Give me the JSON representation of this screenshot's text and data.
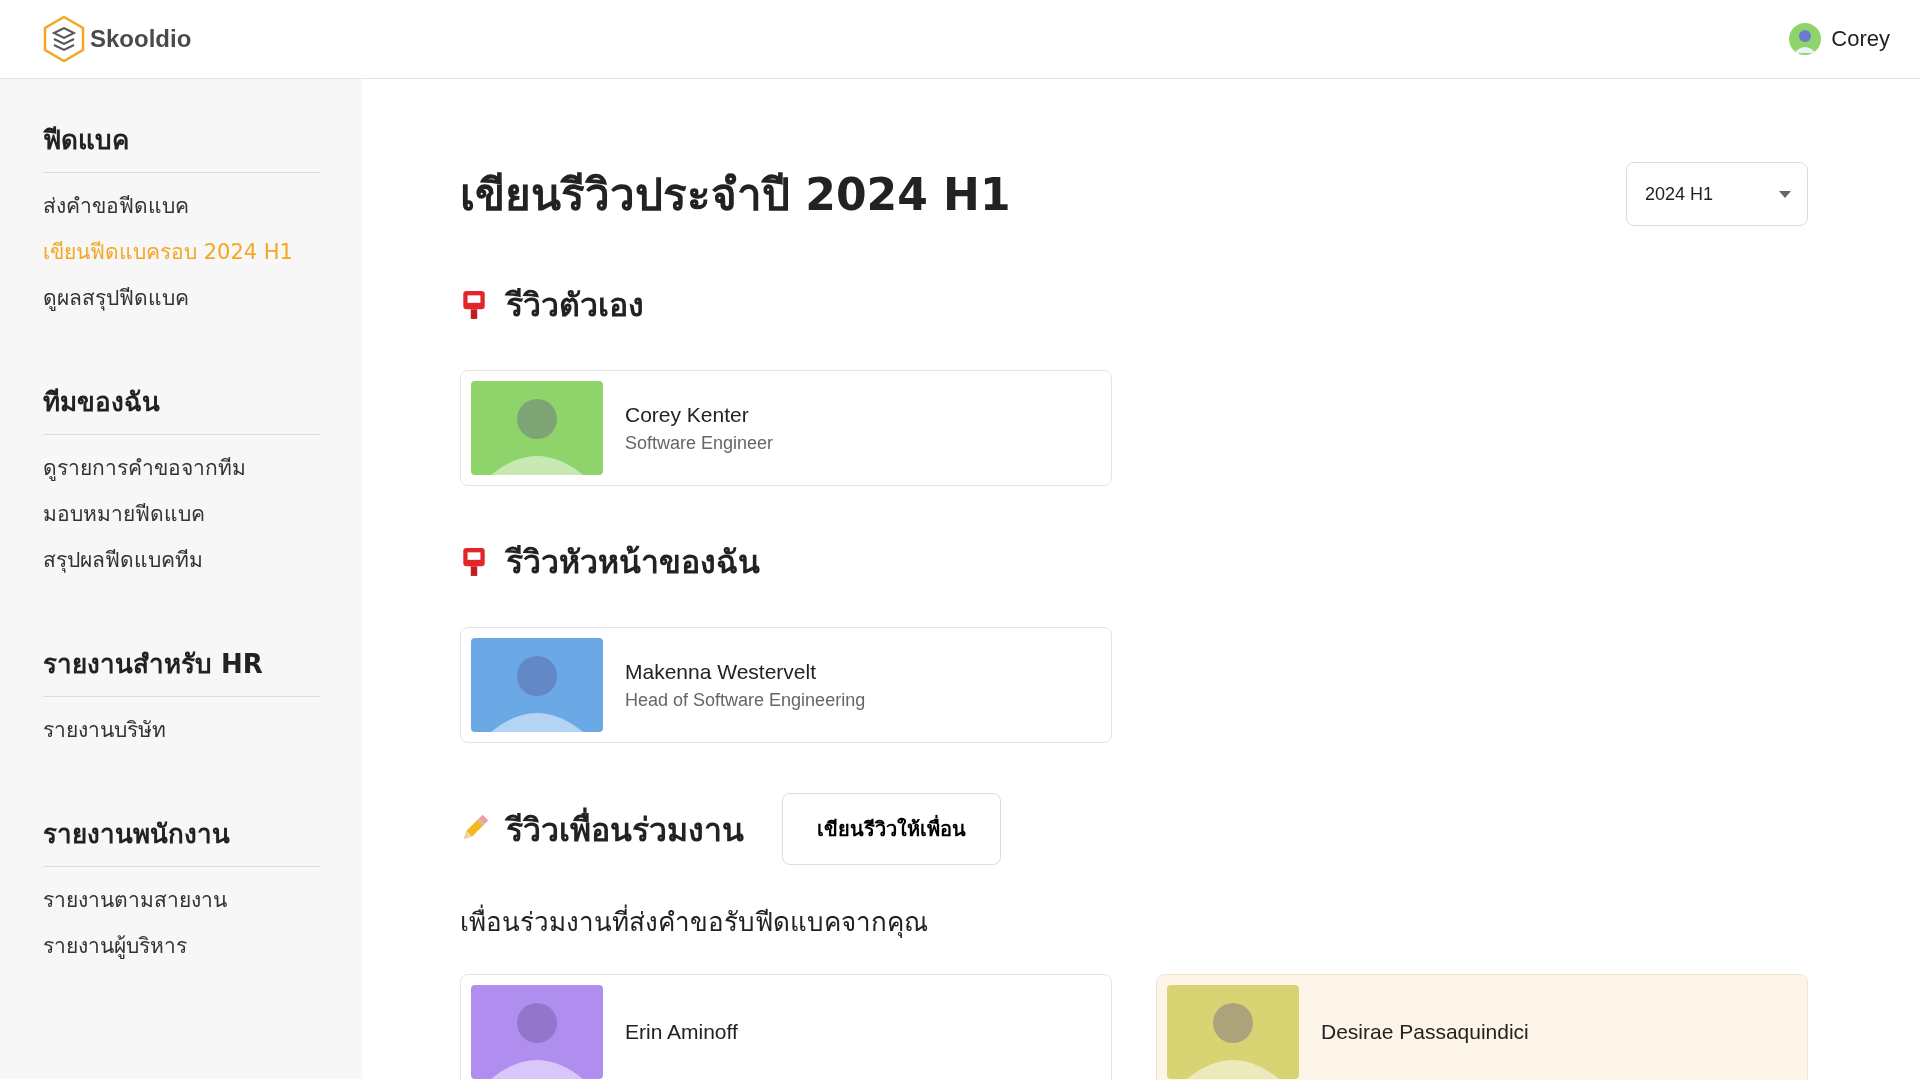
{
  "header": {
    "brand": "Skooldio",
    "user": {
      "name": "Corey",
      "color": "#8fd46a"
    }
  },
  "sidebar": {
    "groups": [
      {
        "title": "ฟีดแบค",
        "items": [
          {
            "label": "ส่งคำขอฟีดแบค",
            "selected": false
          },
          {
            "label": "เขียนฟีดแบครอบ 2024 H1",
            "selected": true
          },
          {
            "label": "ดูผลสรุปฟีดแบค",
            "selected": false
          }
        ]
      },
      {
        "title": "ทีมของฉัน",
        "items": [
          {
            "label": "ดูรายการคำขอจากทีม",
            "selected": false
          },
          {
            "label": "มอบหมายฟีดแบค",
            "selected": false
          },
          {
            "label": "สรุปผลฟีดแบคทีม",
            "selected": false
          }
        ]
      },
      {
        "title": "รายงานสำหรับ HR",
        "items": [
          {
            "label": "รายงานบริษัท",
            "selected": false
          }
        ]
      },
      {
        "title": "รายงานพนักงาน",
        "items": [
          {
            "label": "รายงานตามสายงาน",
            "selected": false
          },
          {
            "label": "รายงานผู้บริหาร",
            "selected": false
          }
        ]
      }
    ]
  },
  "main": {
    "title": "เขียนรีวิวประจำปี 2024 H1",
    "period_select": {
      "value": "2024 H1"
    },
    "sections": [
      {
        "kind": "mailbox",
        "heading": "รีวิวตัวเอง",
        "people": [
          {
            "name": "Corey Kenter",
            "role": "Software Engineer",
            "color": "#8fd46a",
            "selected": false
          }
        ]
      },
      {
        "kind": "mailbox",
        "heading": "รีวิวหัวหน้าของฉัน",
        "people": [
          {
            "name": "Makenna Westervelt",
            "role": "Head of Software Engineering",
            "color": "#6aa8e6",
            "selected": false
          }
        ]
      },
      {
        "kind": "pencil",
        "heading": "รีวิวเพื่อนร่วมงาน",
        "button": "เขียนรีวิวให้เพื่อน",
        "subheading": "เพื่อนร่วมงานที่ส่งคำขอรับฟีดแบคจากคุณ",
        "people": [
          {
            "name": "Erin Aminoff",
            "color": "#b08ef0",
            "selected": false
          },
          {
            "name": "Desirae Passaquindici",
            "color": "#d8d474",
            "selected": true
          }
        ]
      }
    ]
  }
}
